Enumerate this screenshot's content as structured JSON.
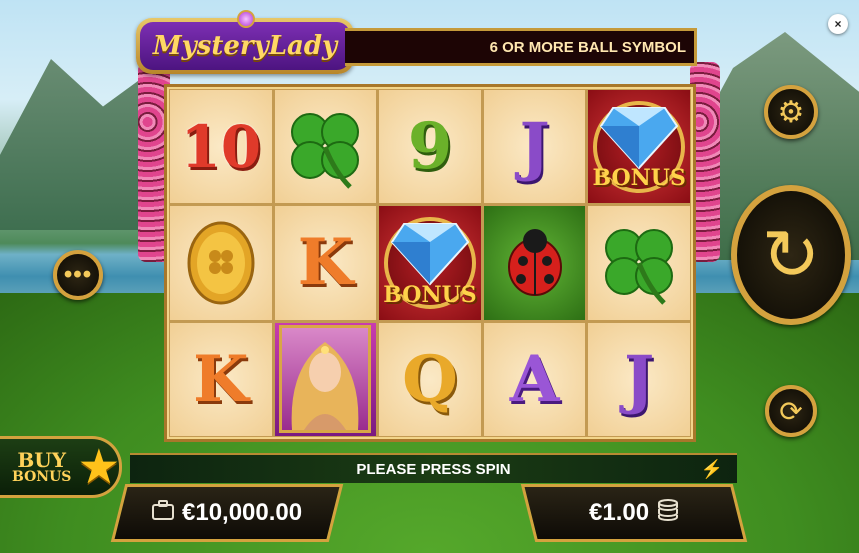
{
  "game": {
    "logo_text": "MysteryLady",
    "banner_text": "6 OR MORE BALL SYMBOL"
  },
  "reels": [
    [
      {
        "type": "num",
        "symbol": "10"
      },
      {
        "type": "clover",
        "symbol": "clover"
      },
      {
        "type": "num9",
        "symbol": "9"
      },
      {
        "type": "numj",
        "symbol": "J"
      },
      {
        "type": "bonus",
        "symbol": "BONUS"
      }
    ],
    [
      {
        "type": "coin",
        "symbol": "coin"
      },
      {
        "type": "numk",
        "symbol": "K"
      },
      {
        "type": "bonus",
        "symbol": "BONUS"
      },
      {
        "type": "ladybug",
        "symbol": "ladybug"
      },
      {
        "type": "clover",
        "symbol": "clover"
      }
    ],
    [
      {
        "type": "numk",
        "symbol": "K"
      },
      {
        "type": "lady",
        "symbol": "lady"
      },
      {
        "type": "numq",
        "symbol": "Q"
      },
      {
        "type": "numa",
        "symbol": "A"
      },
      {
        "type": "numj",
        "symbol": "J"
      }
    ]
  ],
  "status": {
    "message": "PLEASE PRESS SPIN"
  },
  "buy_bonus": {
    "line1": "BUY",
    "line2": "BONUS"
  },
  "balance": {
    "value": "€10,000.00"
  },
  "bet": {
    "value": "€1.00"
  },
  "buttons": {
    "close": "×",
    "menu": "•••",
    "settings": "⚙",
    "spin": "↻",
    "autoplay": "⟳"
  },
  "icons": {
    "balance": "briefcase-icon",
    "bet": "coins-icon",
    "turbo": "lightning-icon"
  },
  "colors": {
    "gold": "#d4a23e",
    "reel_bg": "#f1cf94"
  }
}
